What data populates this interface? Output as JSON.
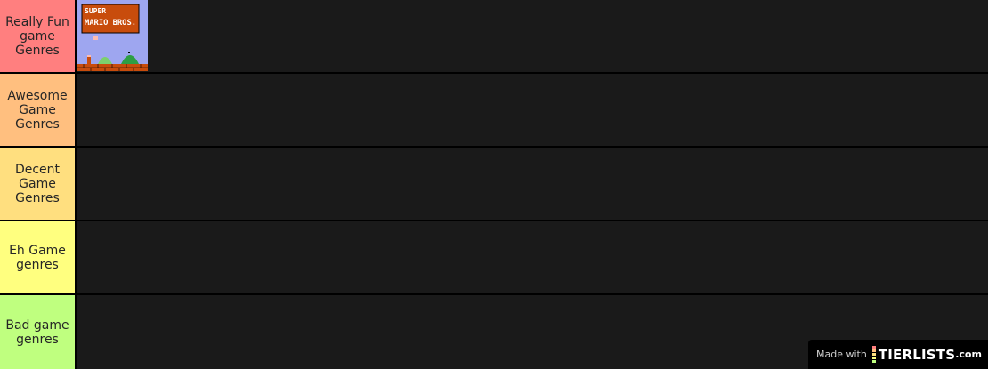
{
  "tiers": [
    {
      "label": "Really Fun game Genres",
      "color": "#ff7f7f",
      "items": [
        {
          "title": "SUPER MARIO BROS.",
          "image": "super-mario-bros-title-screen"
        }
      ]
    },
    {
      "label": "Awesome Game Genres",
      "color": "#ffbf7f",
      "items": []
    },
    {
      "label": "Decent Game Genres",
      "color": "#ffdf7f",
      "items": []
    },
    {
      "label": "Eh Game genres",
      "color": "#ffff7f",
      "items": []
    },
    {
      "label": "Bad game genres",
      "color": "#bfff7f",
      "items": []
    }
  ],
  "theme": {
    "row_background": "#1a1a1a",
    "separator": "#000000",
    "label_text": "#262626"
  },
  "watermark": {
    "made_with": "Made with",
    "brand": "TIERLISTS",
    "brand_suffix": ".com",
    "bar_colors": [
      "#ff7f7f",
      "#ffbf7f",
      "#ffdf7f",
      "#ffff7f",
      "#bfff7f"
    ]
  }
}
